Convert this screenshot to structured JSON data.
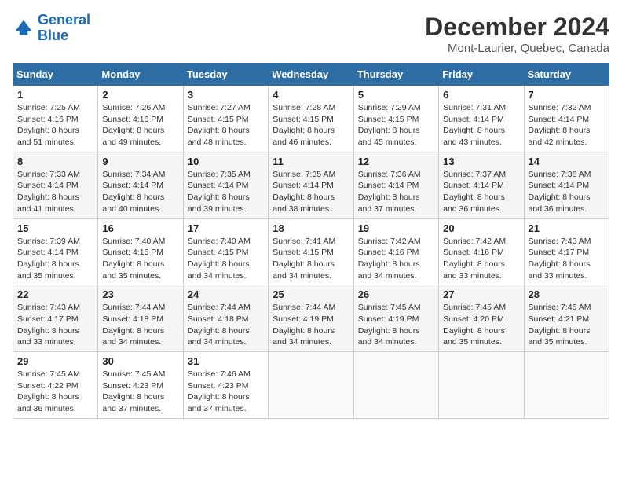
{
  "logo": {
    "line1": "General",
    "line2": "Blue"
  },
  "title": "December 2024",
  "subtitle": "Mont-Laurier, Quebec, Canada",
  "headers": [
    "Sunday",
    "Monday",
    "Tuesday",
    "Wednesday",
    "Thursday",
    "Friday",
    "Saturday"
  ],
  "weeks": [
    [
      {
        "day": "1",
        "sunrise": "7:25 AM",
        "sunset": "4:16 PM",
        "daylight": "8 hours and 51 minutes."
      },
      {
        "day": "2",
        "sunrise": "7:26 AM",
        "sunset": "4:16 PM",
        "daylight": "8 hours and 49 minutes."
      },
      {
        "day": "3",
        "sunrise": "7:27 AM",
        "sunset": "4:15 PM",
        "daylight": "8 hours and 48 minutes."
      },
      {
        "day": "4",
        "sunrise": "7:28 AM",
        "sunset": "4:15 PM",
        "daylight": "8 hours and 46 minutes."
      },
      {
        "day": "5",
        "sunrise": "7:29 AM",
        "sunset": "4:15 PM",
        "daylight": "8 hours and 45 minutes."
      },
      {
        "day": "6",
        "sunrise": "7:31 AM",
        "sunset": "4:14 PM",
        "daylight": "8 hours and 43 minutes."
      },
      {
        "day": "7",
        "sunrise": "7:32 AM",
        "sunset": "4:14 PM",
        "daylight": "8 hours and 42 minutes."
      }
    ],
    [
      {
        "day": "8",
        "sunrise": "7:33 AM",
        "sunset": "4:14 PM",
        "daylight": "8 hours and 41 minutes."
      },
      {
        "day": "9",
        "sunrise": "7:34 AM",
        "sunset": "4:14 PM",
        "daylight": "8 hours and 40 minutes."
      },
      {
        "day": "10",
        "sunrise": "7:35 AM",
        "sunset": "4:14 PM",
        "daylight": "8 hours and 39 minutes."
      },
      {
        "day": "11",
        "sunrise": "7:35 AM",
        "sunset": "4:14 PM",
        "daylight": "8 hours and 38 minutes."
      },
      {
        "day": "12",
        "sunrise": "7:36 AM",
        "sunset": "4:14 PM",
        "daylight": "8 hours and 37 minutes."
      },
      {
        "day": "13",
        "sunrise": "7:37 AM",
        "sunset": "4:14 PM",
        "daylight": "8 hours and 36 minutes."
      },
      {
        "day": "14",
        "sunrise": "7:38 AM",
        "sunset": "4:14 PM",
        "daylight": "8 hours and 36 minutes."
      }
    ],
    [
      {
        "day": "15",
        "sunrise": "7:39 AM",
        "sunset": "4:14 PM",
        "daylight": "8 hours and 35 minutes."
      },
      {
        "day": "16",
        "sunrise": "7:40 AM",
        "sunset": "4:15 PM",
        "daylight": "8 hours and 35 minutes."
      },
      {
        "day": "17",
        "sunrise": "7:40 AM",
        "sunset": "4:15 PM",
        "daylight": "8 hours and 34 minutes."
      },
      {
        "day": "18",
        "sunrise": "7:41 AM",
        "sunset": "4:15 PM",
        "daylight": "8 hours and 34 minutes."
      },
      {
        "day": "19",
        "sunrise": "7:42 AM",
        "sunset": "4:16 PM",
        "daylight": "8 hours and 34 minutes."
      },
      {
        "day": "20",
        "sunrise": "7:42 AM",
        "sunset": "4:16 PM",
        "daylight": "8 hours and 33 minutes."
      },
      {
        "day": "21",
        "sunrise": "7:43 AM",
        "sunset": "4:17 PM",
        "daylight": "8 hours and 33 minutes."
      }
    ],
    [
      {
        "day": "22",
        "sunrise": "7:43 AM",
        "sunset": "4:17 PM",
        "daylight": "8 hours and 33 minutes."
      },
      {
        "day": "23",
        "sunrise": "7:44 AM",
        "sunset": "4:18 PM",
        "daylight": "8 hours and 34 minutes."
      },
      {
        "day": "24",
        "sunrise": "7:44 AM",
        "sunset": "4:18 PM",
        "daylight": "8 hours and 34 minutes."
      },
      {
        "day": "25",
        "sunrise": "7:44 AM",
        "sunset": "4:19 PM",
        "daylight": "8 hours and 34 minutes."
      },
      {
        "day": "26",
        "sunrise": "7:45 AM",
        "sunset": "4:19 PM",
        "daylight": "8 hours and 34 minutes."
      },
      {
        "day": "27",
        "sunrise": "7:45 AM",
        "sunset": "4:20 PM",
        "daylight": "8 hours and 35 minutes."
      },
      {
        "day": "28",
        "sunrise": "7:45 AM",
        "sunset": "4:21 PM",
        "daylight": "8 hours and 35 minutes."
      }
    ],
    [
      {
        "day": "29",
        "sunrise": "7:45 AM",
        "sunset": "4:22 PM",
        "daylight": "8 hours and 36 minutes."
      },
      {
        "day": "30",
        "sunrise": "7:45 AM",
        "sunset": "4:23 PM",
        "daylight": "8 hours and 37 minutes."
      },
      {
        "day": "31",
        "sunrise": "7:46 AM",
        "sunset": "4:23 PM",
        "daylight": "8 hours and 37 minutes."
      },
      null,
      null,
      null,
      null
    ]
  ],
  "labels": {
    "sunrise": "Sunrise:",
    "sunset": "Sunset:",
    "daylight": "Daylight:"
  }
}
